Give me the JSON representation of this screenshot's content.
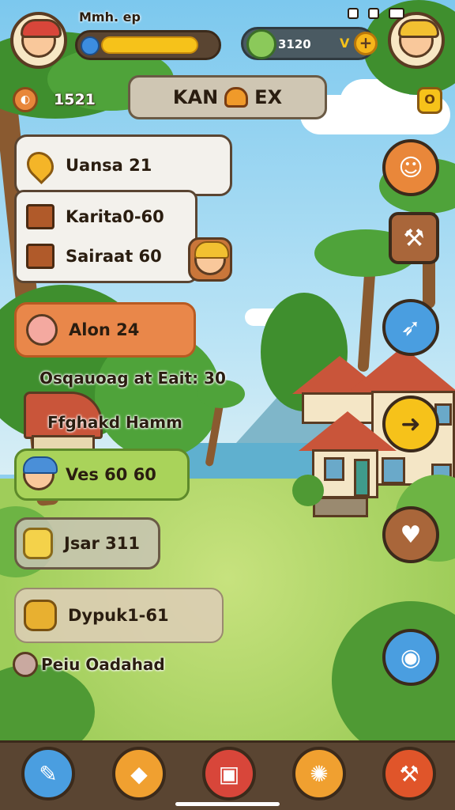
{
  "header": {
    "player_name": "Mmh. ep",
    "xp_progress": 0.85,
    "currency_value": "3120",
    "currency_suffix": "V",
    "plus_label": "+",
    "coins": "1521",
    "title_left": "KAN",
    "title_right": "EX",
    "small_btn": "O"
  },
  "left_panels": [
    {
      "label": "Uansa 21",
      "style": "white",
      "icon": "map-pin-icon"
    },
    {
      "label": "Karita0-60",
      "style": "white",
      "icon": "chest-icon"
    },
    {
      "label": "Sairaat 60",
      "style": "white",
      "icon": "chest-icon"
    },
    {
      "label": "Alon 24",
      "style": "orange",
      "icon": "bunny-face-icon"
    },
    {
      "label": "Osqauoag at Eait: 30",
      "style": "plain"
    },
    {
      "label": "Ffghakd Hamm",
      "style": "plain"
    },
    {
      "label": "Ves 60 60",
      "style": "green",
      "icon": "boy-face-icon"
    },
    {
      "label": "Jsar 311",
      "style": "grey",
      "icon": "jar-icon"
    },
    {
      "label": "Dypuk1-61",
      "style": "tan",
      "icon": "barrel-icon"
    },
    {
      "label": "Peiu Oadahad",
      "style": "plain",
      "icon": "gem-icon"
    }
  ],
  "right_buttons": [
    {
      "name": "character-button",
      "icon": "cat-face-icon",
      "glyph": "☺",
      "color": "orange"
    },
    {
      "name": "tool-button",
      "icon": "pin-tool-icon",
      "glyph": "⚒",
      "color": "brown"
    },
    {
      "name": "feather-button",
      "icon": "feather-icon",
      "glyph": "➶",
      "color": "blue"
    },
    {
      "name": "arrow-button",
      "icon": "arrow-right-icon",
      "glyph": "➜",
      "color": "yellow"
    },
    {
      "name": "pig-button",
      "icon": "pig-face-icon",
      "glyph": "♥",
      "color": "brown"
    },
    {
      "name": "globe-button",
      "icon": "globe-icon",
      "glyph": "◉",
      "color": "blue"
    }
  ],
  "bottom_nav": [
    {
      "name": "nav-quill",
      "icon": "quill-icon",
      "glyph": "✎",
      "color": "#4a9ee0"
    },
    {
      "name": "nav-shield",
      "icon": "shield-icon",
      "glyph": "◆",
      "color": "#f0a030"
    },
    {
      "name": "nav-book",
      "icon": "book-icon",
      "glyph": "▣",
      "color": "#d8463a"
    },
    {
      "name": "nav-sun",
      "icon": "sun-icon",
      "glyph": "✺",
      "color": "#f0a030"
    },
    {
      "name": "nav-hammer",
      "icon": "hammer-icon",
      "glyph": "⚒",
      "color": "#e0552a"
    }
  ]
}
